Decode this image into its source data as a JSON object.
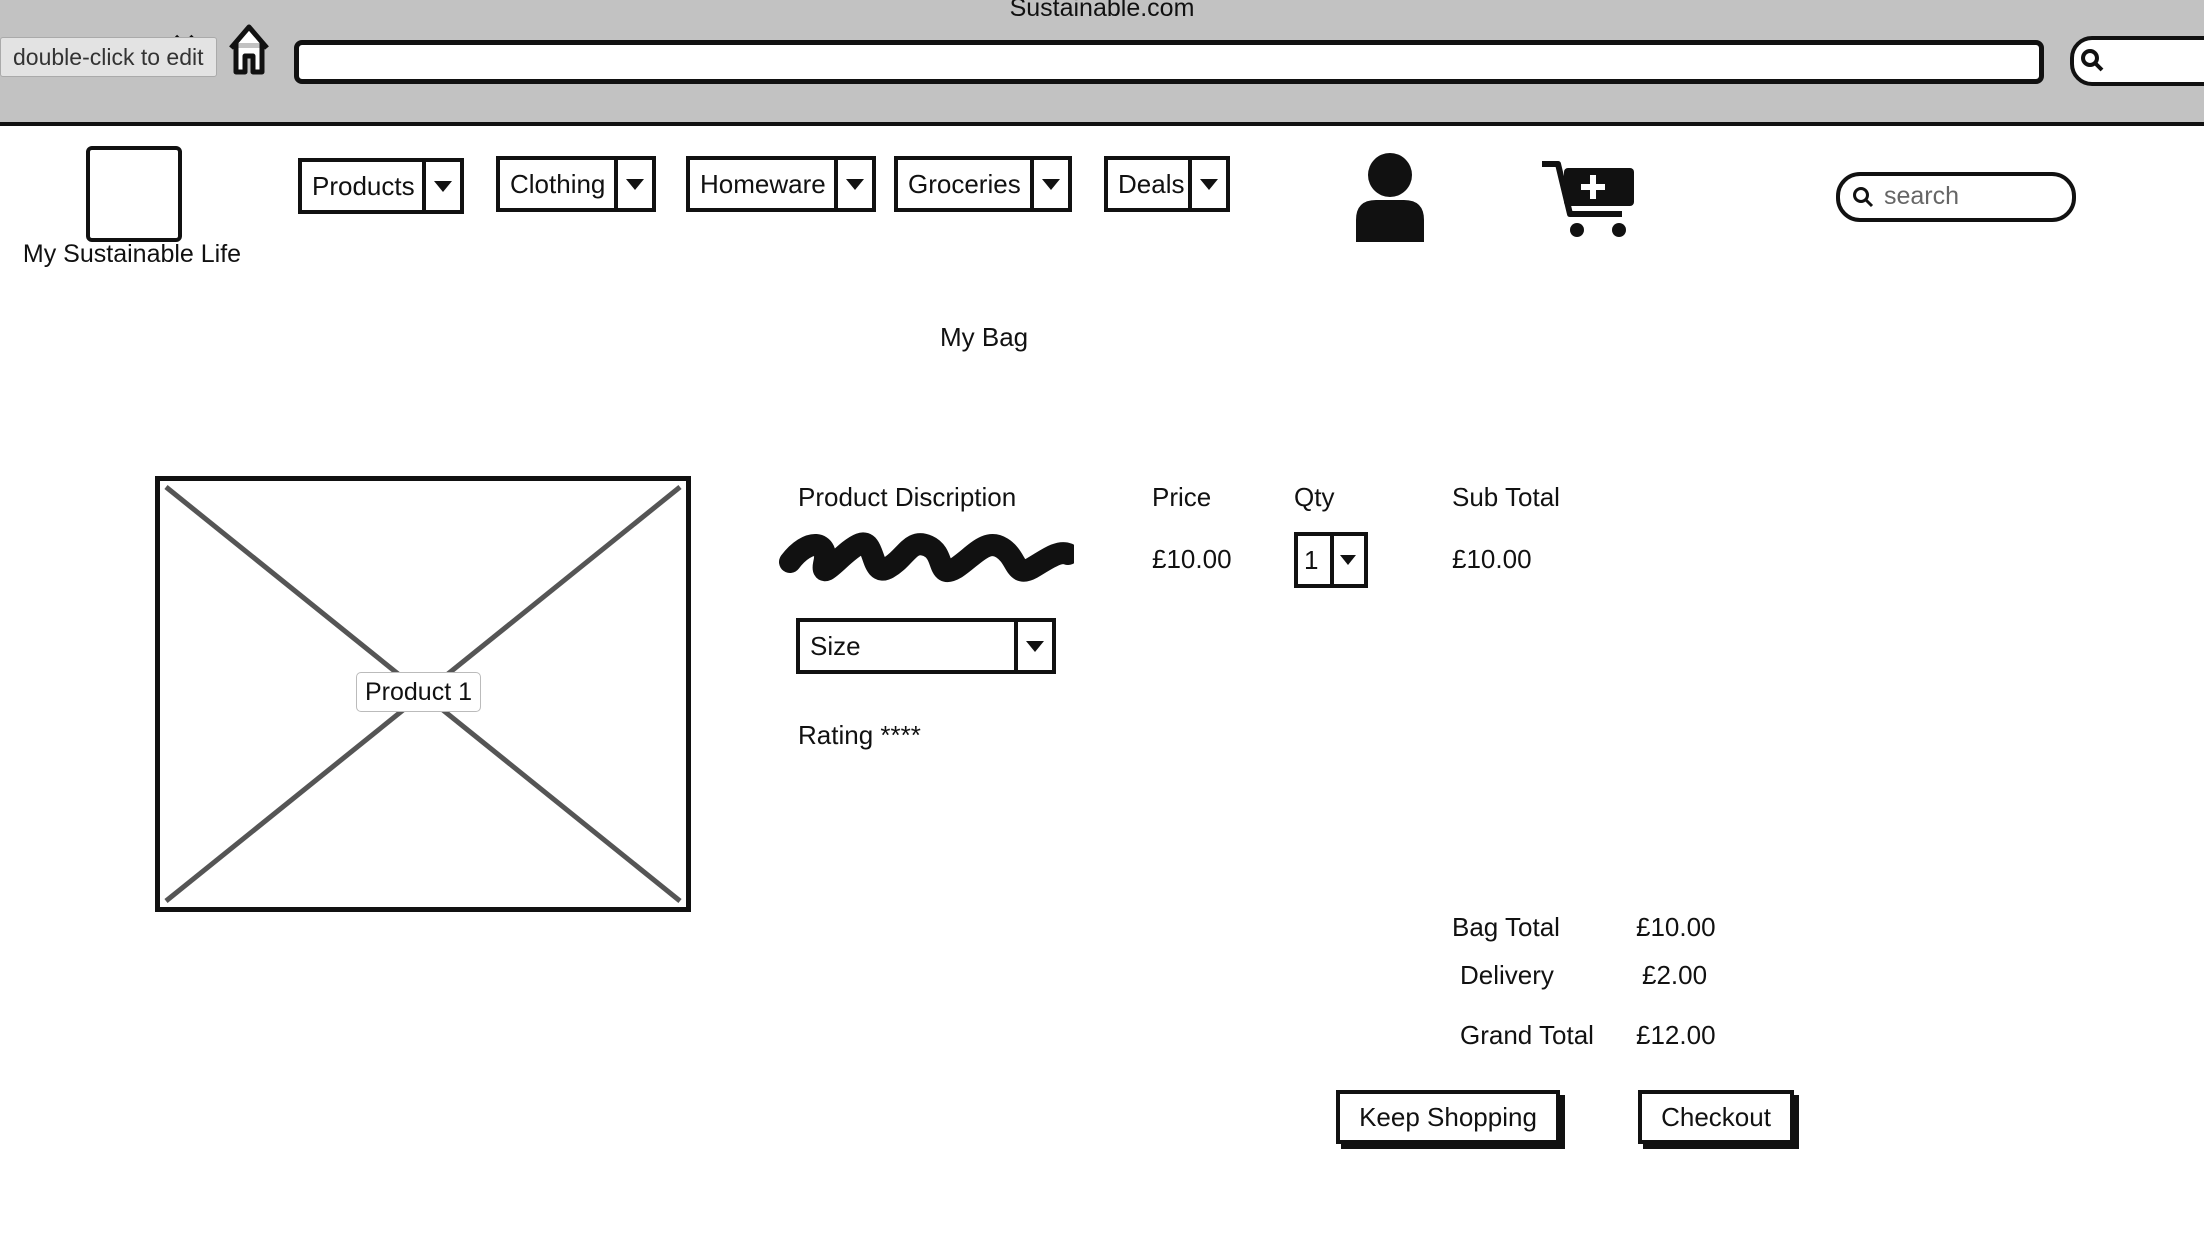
{
  "browser": {
    "window_title": "Sustainable.com",
    "tooltip": "double-click to edit",
    "url": ""
  },
  "header": {
    "brand": "My Sustainable Life",
    "nav": [
      {
        "label": "Products"
      },
      {
        "label": "Clothing"
      },
      {
        "label": "Homeware"
      },
      {
        "label": "Groceries"
      },
      {
        "label": "Deals"
      }
    ],
    "search_placeholder": "search"
  },
  "bag": {
    "title": "My Bag",
    "columns": {
      "description": "Product Discription",
      "price": "Price",
      "qty": "Qty",
      "subtotal": "Sub Total"
    },
    "item": {
      "image_label": "Product 1",
      "price": "£10.00",
      "qty": "1",
      "subtotal": "£10.00",
      "size_label": "Size",
      "rating": "Rating ****"
    },
    "summary": {
      "bag_total_label": "Bag Total",
      "bag_total_value": "£10.00",
      "delivery_label": "Delivery",
      "delivery_value": "£2.00",
      "grand_total_label": "Grand Total",
      "grand_total_value": "£12.00"
    },
    "buttons": {
      "keep_shopping": "Keep Shopping",
      "checkout": "Checkout"
    }
  }
}
